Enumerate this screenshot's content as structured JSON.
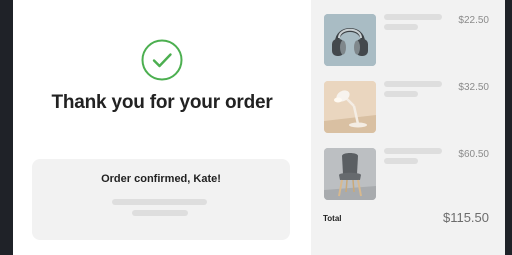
{
  "confirmation": {
    "title": "Thank you for your order",
    "message": "Order confirmed, Kate!",
    "icon": "check-circle-icon",
    "accent_color": "#4caf50"
  },
  "order_items": [
    {
      "icon": "headphones-image",
      "price": "$22.50"
    },
    {
      "icon": "desk-lamp-image",
      "price": "$32.50"
    },
    {
      "icon": "chair-image",
      "price": "$60.50"
    }
  ],
  "summary": {
    "total_label": "Total",
    "total_value": "$115.50"
  }
}
